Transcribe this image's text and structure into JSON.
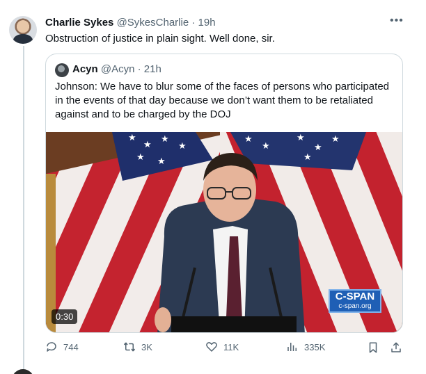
{
  "tweet": {
    "author_name": "Charlie Sykes",
    "author_handle": "@SykesCharlie",
    "time": "· 19h",
    "text": "Obstruction of justice in plain sight. Well done, sir.",
    "more_icon": "more-horizontal-icon"
  },
  "quoted": {
    "author_name": "Acyn",
    "author_handle": "@Acyn",
    "time": "· 21h",
    "text": "Johnson: We have to blur some of the faces of persons who participated in the events of that day because we don’t want them to be retaliated against and to be charged by the DOJ",
    "video": {
      "duration": "0:30",
      "watermark_main": "C-SPAN",
      "watermark_sub": "c-span.org"
    }
  },
  "actions": {
    "replies": "744",
    "reposts": "3K",
    "likes": "11K",
    "views": "335K",
    "icons": [
      "reply-icon",
      "repost-icon",
      "like-icon",
      "views-icon",
      "bookmark-icon",
      "share-icon"
    ]
  },
  "colors": {
    "text": "#0f1419",
    "secondary": "#536471",
    "border": "#cfd9de",
    "cspan_blue": "#1f5fb5"
  }
}
